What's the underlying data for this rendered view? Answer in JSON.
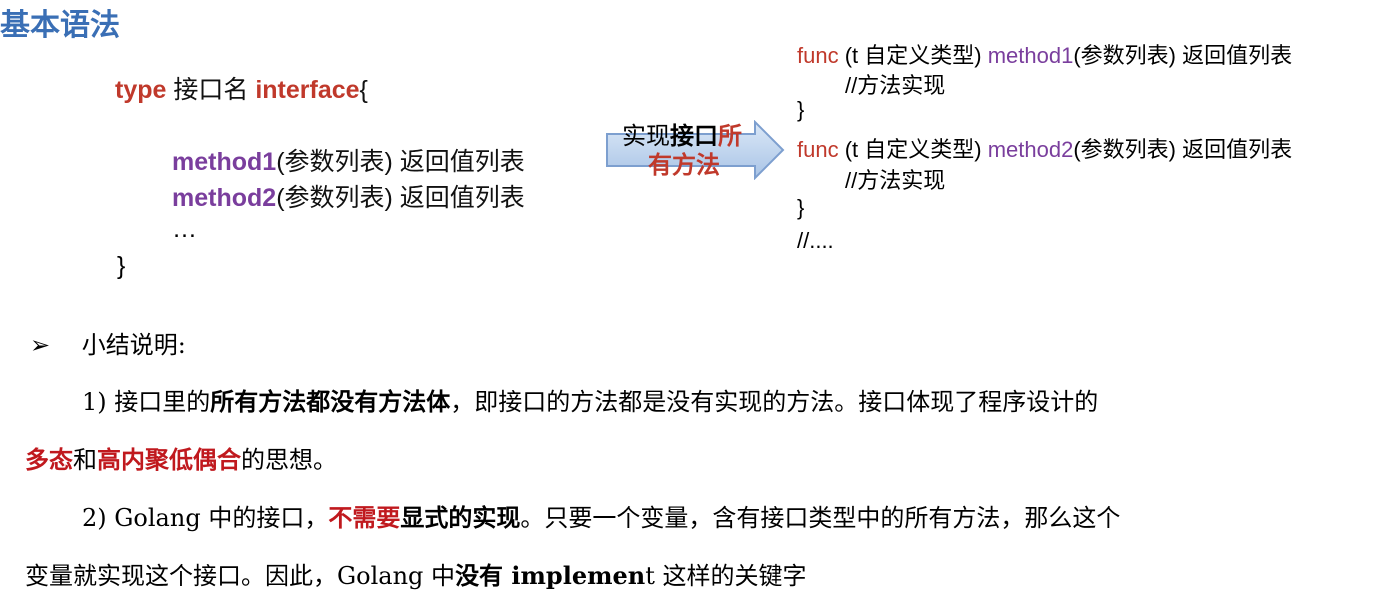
{
  "heading": "基本语法",
  "left_code": {
    "line1_type": "type",
    "line1_name": " 接口名 ",
    "line1_interface": "interface",
    "line1_brace": "{",
    "m1_name": "method1",
    "m1_sig": "(参数列表) 返回值列表",
    "m2_name": "method2",
    "m2_sig": "(参数列表) 返回值列表",
    "ellipsis": "…",
    "close": "}"
  },
  "arrow": {
    "text_a": "实现",
    "text_b": "接口",
    "text_c": "所",
    "text_d": "有方法"
  },
  "right_code": {
    "f1_func": "func",
    "f1_recv": " (t 自定义类型) ",
    "f1_method": "method1",
    "f1_sig": "(参数列表) 返回值列表",
    "f1_comment": "//方法实现",
    "f1_close": "}",
    "f2_func": "func",
    "f2_recv": " (t 自定义类型) ",
    "f2_method": "method2",
    "f2_sig": "(参数列表) 返回值列表",
    "f2_comment": "//方法实现",
    "f2_close": "}",
    "more": "//...."
  },
  "summary": {
    "bullet": "➢",
    "title": "小结说明:",
    "p1_a": "1)  接口里的",
    "p1_b": "所有方法都没有方法体",
    "p1_c": "，即接口的方法都是没有实现的方法。接口体现了程序设计的",
    "p1_d": "多态",
    "p1_e": "和",
    "p1_f": "高内聚低偶合",
    "p1_g": "的思想。",
    "p2_a": "2)  Golang 中的接口，",
    "p2_b": "不需要",
    "p2_c": "显式的实现",
    "p2_d": "。只要一个变量，含有接口类型中的所有方法，那么这个",
    "p2_e": "变量就实现这个接口。因此，Golang 中",
    "p2_f": "没有 implemen",
    "p2_g": "t 这样的关键字"
  }
}
